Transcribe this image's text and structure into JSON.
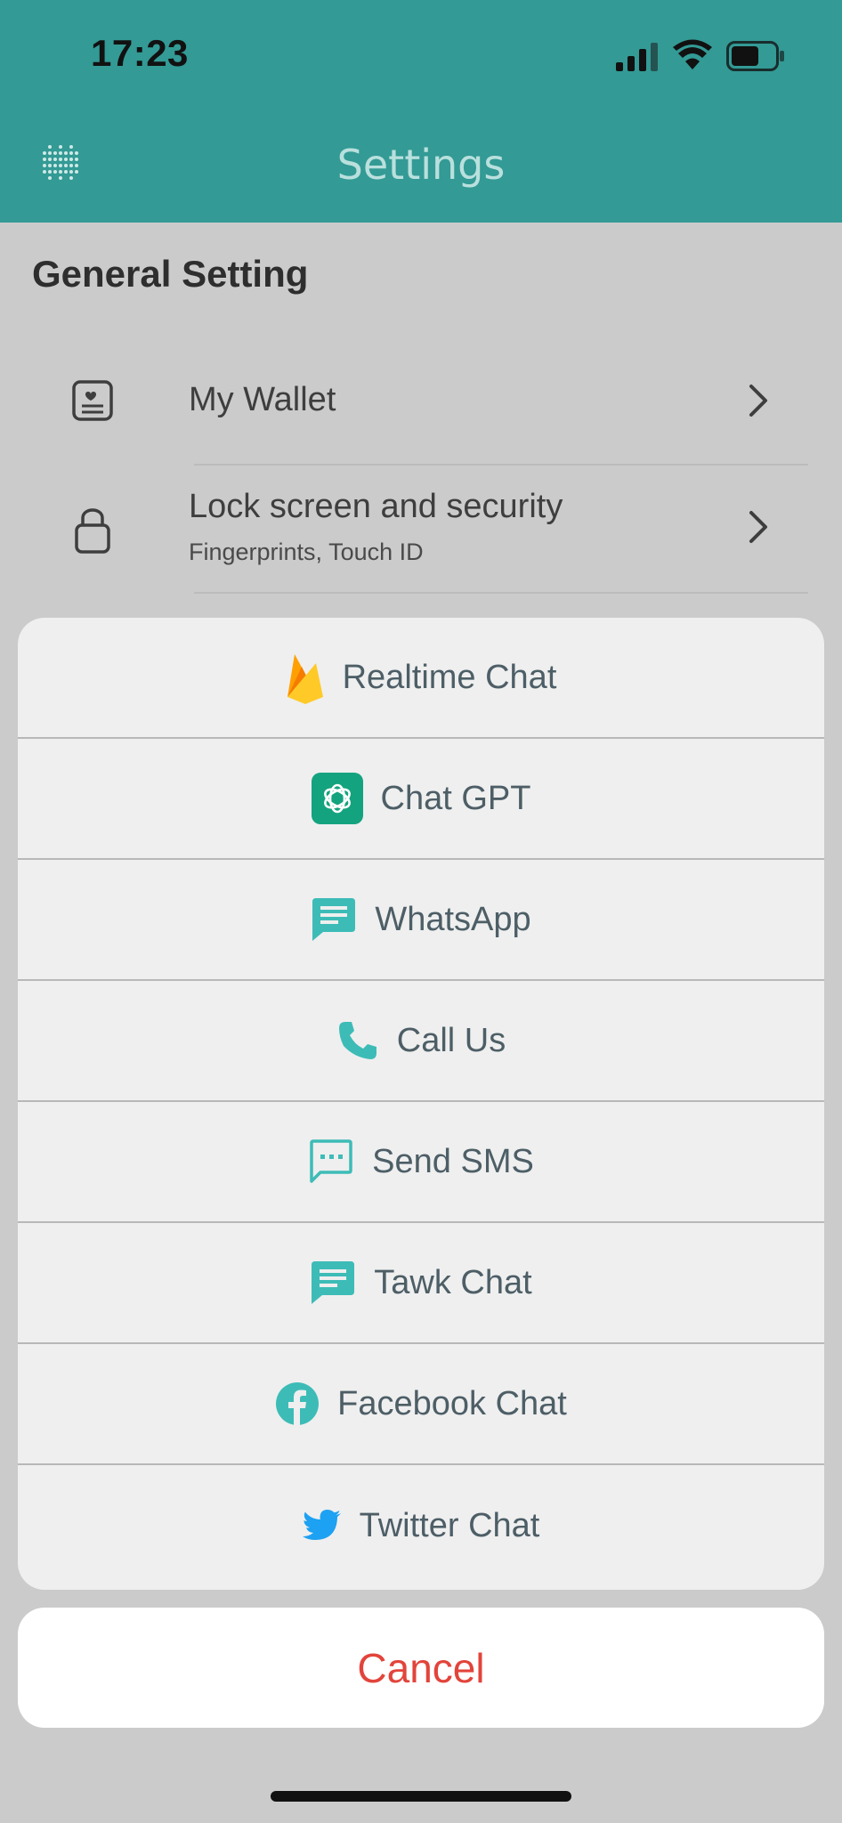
{
  "status_bar": {
    "time": "17:23"
  },
  "header": {
    "title": "Settings",
    "menu_icon": "dots-grid-icon"
  },
  "general": {
    "section_title": "General Setting",
    "rows": [
      {
        "label": "My Wallet",
        "icon": "wallet-icon"
      },
      {
        "label": "Lock screen and security",
        "sublabel": "Fingerprints, Touch ID",
        "icon": "lock-icon"
      }
    ]
  },
  "action_sheet": {
    "options": [
      {
        "label": "Realtime Chat",
        "icon": "firebase-icon"
      },
      {
        "label": "Chat GPT",
        "icon": "chatgpt-icon"
      },
      {
        "label": "WhatsApp",
        "icon": "message-icon"
      },
      {
        "label": "Call Us",
        "icon": "phone-icon"
      },
      {
        "label": "Send SMS",
        "icon": "sms-icon"
      },
      {
        "label": "Tawk Chat",
        "icon": "message-icon"
      },
      {
        "label": "Facebook Chat",
        "icon": "facebook-icon"
      },
      {
        "label": "Twitter Chat",
        "icon": "twitter-icon"
      }
    ],
    "cancel_label": "Cancel"
  },
  "colors": {
    "header": "#339a95",
    "accent": "#3dbcb7",
    "cancel": "#e2443b",
    "backdrop": "#cbcbcb"
  }
}
